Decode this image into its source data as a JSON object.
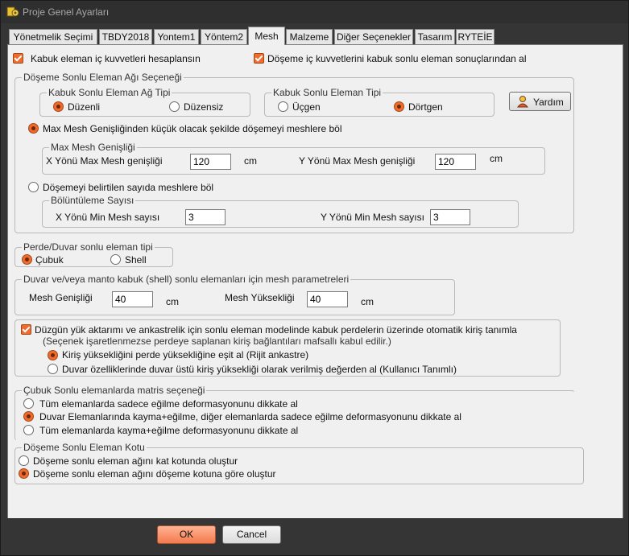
{
  "window": {
    "title": "Proje Genel Ayarları"
  },
  "tabs": [
    "Yönetmelik Seçimi",
    "TBDY2018",
    "Yontem1",
    "Yöntem2",
    "Mesh",
    "Malzeme",
    "Diğer Seçenekler",
    "Tasarım",
    "RYTEİE"
  ],
  "top": {
    "kabuk_check": "Kabuk eleman iç kuvvetleri hesaplansın",
    "doseme_check": "Döşeme iç kuvvetlerini kabuk sonlu eleman sonuçlarından al"
  },
  "ag_secenegi": {
    "caption": "Döşeme Sonlu Eleman Ağı Seçeneği",
    "ag_tipi": {
      "caption": "Kabuk Sonlu Eleman Ağ Tipi",
      "opt1": "Düzenli",
      "opt2": "Düzensiz"
    },
    "eleman_tipi": {
      "caption": "Kabuk Sonlu Eleman Tipi",
      "opt1": "Üçgen",
      "opt2": "Dörtgen"
    },
    "help_label": "Yardım",
    "max_mesh_radio": "Max Mesh Genişliğinden küçük olacak şekilde döşemeyi meshlere böl",
    "max_mesh": {
      "caption": "Max Mesh Genişliği",
      "x_label": "X Yönü Max Mesh genişliği",
      "x_value": "120",
      "x_unit": "cm",
      "y_label": "Y Yönü Max Mesh genişliği",
      "y_value": "120",
      "y_unit": "cm"
    },
    "sayi_radio": "Döşemeyi belirtilen sayıda meshlere böl",
    "bolutleme": {
      "caption": "Bölüntüleme Sayısı",
      "x_label": "X Yönü Min Mesh sayısı",
      "x_value": "3",
      "y_label": "Y Yönü Min Mesh sayısı",
      "y_value": "3"
    }
  },
  "perde_tipi": {
    "caption": "Perde/Duvar sonlu eleman tipi",
    "opt1": "Çubuk",
    "opt2": "Shell"
  },
  "duvar_mesh": {
    "caption": "Duvar ve/veya manto kabuk (shell) sonlu elemanları için mesh parametreleri",
    "w_label": "Mesh Genişliği",
    "w_value": "40",
    "w_unit": "cm",
    "h_label": "Mesh Yüksekliği",
    "h_value": "40",
    "h_unit": "cm"
  },
  "kiris": {
    "check": "Düzgün yük aktarımı ve ankastrelik için sonlu eleman modelinde kabuk perdelerin üzerinde otomatik kiriş tanımla",
    "note": "(Seçenek işaretlenmezse perdeye saplanan kiriş bağlantıları mafsallı kabul edilir.)",
    "opt1": "Kiriş yüksekliğini perde yüksekliğine eşit al (Rijit ankastre)",
    "opt2": "Duvar özelliklerinde duvar üstü kiriş yüksekliği olarak verilmiş değerden al (Kullanıcı Tanımlı)"
  },
  "matris": {
    "caption": "Çubuk Sonlu elemanlarda matris seçeneği",
    "opt1": "Tüm elemanlarda sadece eğilme deformasyonunu dikkate al",
    "opt2": "Duvar Elemanlarında kayma+eğilme, diğer elemanlarda sadece eğilme deformasyonunu dikkate al",
    "opt3": "Tüm elemanlarda kayma+eğilme deformasyonunu dikkate al"
  },
  "kotu": {
    "caption": "Döşeme Sonlu Eleman Kotu",
    "opt1": "Döşeme sonlu eleman ağını kat kotunda oluştur",
    "opt2": "Döşeme sonlu eleman ağını döşeme kotuna göre oluştur"
  },
  "footer": {
    "ok": "OK",
    "cancel": "Cancel"
  }
}
